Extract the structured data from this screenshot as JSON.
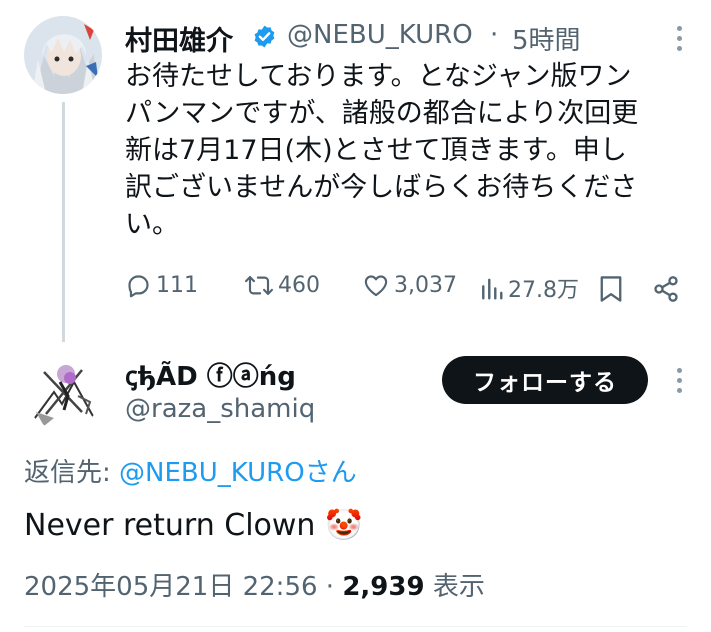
{
  "tweet": {
    "author_name": "村田雄介",
    "handle": "@NEBU_KURO",
    "dot": "·",
    "time": "5時間",
    "text_lines": [
      "お待たせしております。となジャン版ワン",
      "パンマンですが、諸般の都合により次回更",
      "新は7月17日(木)とさせて頂きます。申し",
      "訳ございませんが今しばらくお待ちくださ",
      "い。"
    ],
    "stats": {
      "replies": "111",
      "reposts": "460",
      "likes": "3,037",
      "views": "27.8万"
    }
  },
  "reply": {
    "author_name": "ꞔђÃD ⓕⓐńg",
    "handle": "@raza_shamiq",
    "follow_label": "フォローする",
    "replying_to_prefix": "返信先: ",
    "replying_to_handle": "@NEBU_KUROさん",
    "text": "Never return Clown",
    "emoji": "🤡",
    "timestamp": "2025年05月21日 22:56",
    "sep": "·",
    "view_count": "2,939",
    "view_label": "表示"
  },
  "colors": {
    "text": "#0f1419",
    "secondary": "#536471",
    "link": "#1d9bf0",
    "verified": "#1d9bf0",
    "button_bg": "#0f1419"
  },
  "icons": [
    "verified-badge-icon",
    "more-icon",
    "reply-icon",
    "repost-icon",
    "like-icon",
    "views-icon",
    "bookmark-icon",
    "share-icon"
  ]
}
